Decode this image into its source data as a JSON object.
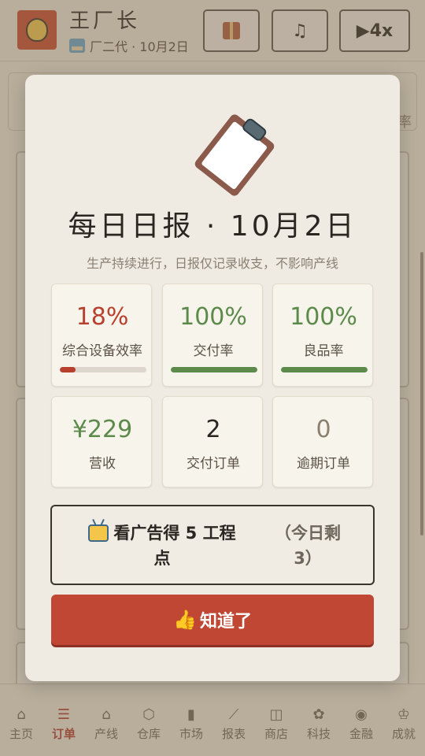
{
  "header": {
    "player_name": "王厂长",
    "player_sub": "厂二代 · 10月2日",
    "speed_label": "▶4x",
    "music_icon": "♫"
  },
  "background": {
    "side_text": "率"
  },
  "tabs": [
    {
      "icon": "⌂",
      "label": "主页"
    },
    {
      "icon": "☰",
      "label": "订单",
      "active": true
    },
    {
      "icon": "⌂",
      "label": "产线"
    },
    {
      "icon": "⬡",
      "label": "仓库"
    },
    {
      "icon": "▮",
      "label": "市场"
    },
    {
      "icon": "⟋",
      "label": "报表"
    },
    {
      "icon": "◫",
      "label": "商店"
    },
    {
      "icon": "✿",
      "label": "科技"
    },
    {
      "icon": "◉",
      "label": "金融"
    },
    {
      "icon": "♔",
      "label": "成就"
    }
  ],
  "modal": {
    "title": "每日日报 · 10月2日",
    "subtitle": "生产持续进行，日报仅记录收支，不影响产线",
    "stats": [
      {
        "value": "18%",
        "label": "综合设备效率",
        "color": "#b8402e",
        "progress": 0.18,
        "bar_color": "#b8402e"
      },
      {
        "value": "100%",
        "label": "交付率",
        "color": "#5b8a4a",
        "progress": 1.0,
        "bar_color": "#5b8a4a"
      },
      {
        "value": "100%",
        "label": "良品率",
        "color": "#5b8a4a",
        "progress": 1.0,
        "bar_color": "#5b8a4a"
      },
      {
        "value": "¥229",
        "label": "营收",
        "color": "#5b8a4a"
      },
      {
        "value": "2",
        "label": "交付订单",
        "color": "#2c2620"
      },
      {
        "value": "0",
        "label": "逾期订单",
        "color": "#8a8072"
      }
    ],
    "ad_button": {
      "main": "看广告得 5 工程点",
      "remaining": "（今日剩 3）"
    },
    "ok_button": {
      "label": "知道了"
    }
  }
}
